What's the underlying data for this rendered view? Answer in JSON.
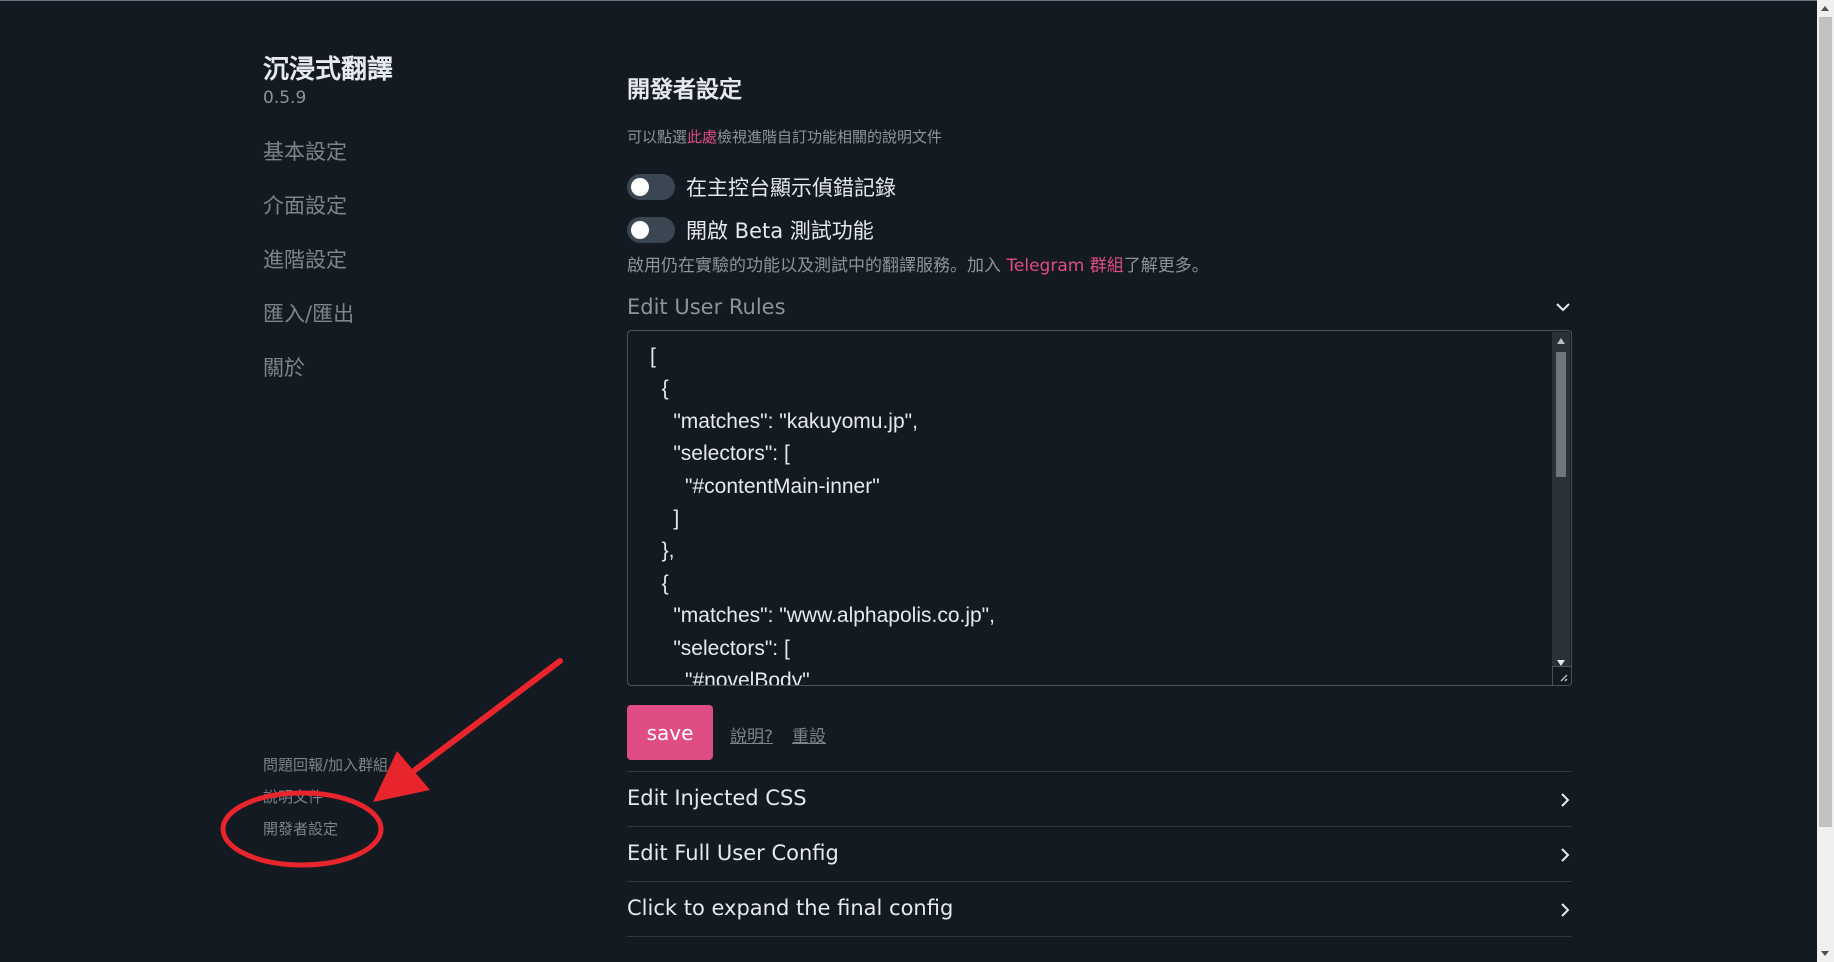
{
  "colors": {
    "background": "#131a21",
    "accent": "#e04c84",
    "annotation": "#e8252c"
  },
  "sidebar": {
    "title": "沉浸式翻譯",
    "version": "0.5.9",
    "nav": [
      "基本設定",
      "介面設定",
      "進階設定",
      "匯入/匯出",
      "關於"
    ],
    "footer": [
      "問題回報/加入群組",
      "說明文件",
      "開發者設定"
    ]
  },
  "main": {
    "title": "開發者設定",
    "hint": {
      "before": "可以點選",
      "link": "此處",
      "after": "檢視進階自訂功能相關的說明文件"
    },
    "toggles": [
      {
        "label": "在主控台顯示偵錯記錄",
        "on": false
      },
      {
        "label": "開啟 Beta 測試功能",
        "on": false
      }
    ],
    "beta_desc": {
      "before": "啟用仍在實驗的功能以及測試中的翻譯服務。加入 ",
      "link": "Telegram 群組",
      "after": "了解更多。"
    },
    "user_rules": {
      "label": "Edit User Rules",
      "code": "[\n  {\n    \"matches\": \"kakuyomu.jp\",\n    \"selectors\": [\n      \"#contentMain-inner\"\n    ]\n  },\n  {\n    \"matches\": \"www.alphapolis.co.jp\",\n    \"selectors\": [\n      \"#novelBody\""
    },
    "save_label": "save",
    "help_label": "說明?",
    "reset_label": "重設",
    "expanders": [
      "Edit Injected CSS",
      "Edit Full User Config",
      "Click to expand the final config"
    ]
  },
  "icons": {
    "section_toggle": "chevron-down-icon",
    "expander": "chevron-right-icon",
    "annotation": [
      "red-arrow",
      "red-ellipse"
    ]
  }
}
